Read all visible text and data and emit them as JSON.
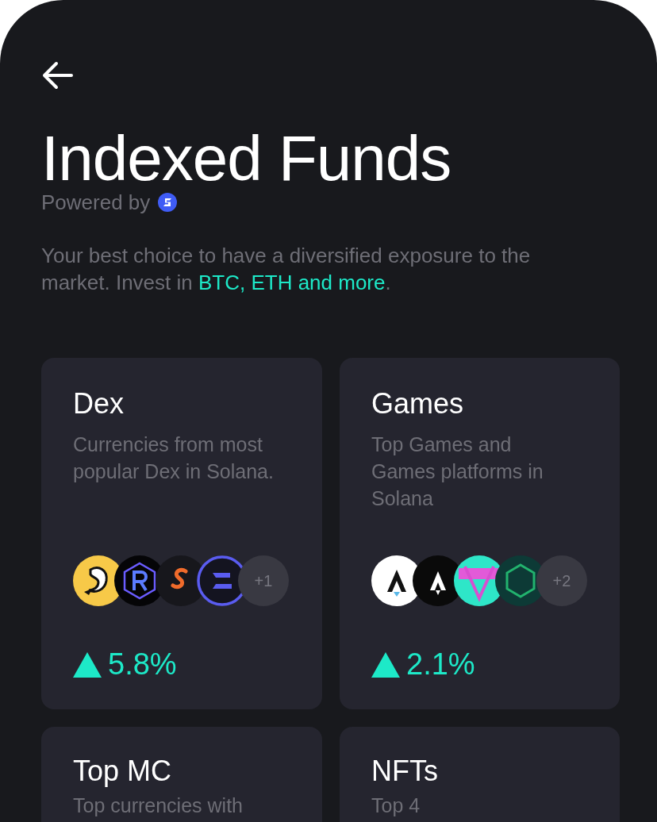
{
  "header": {
    "title": "Indexed Funds",
    "powered_by": "Powered by"
  },
  "intro": {
    "text": "Your best choice to have a diversified exposure to the market. Invest in ",
    "link": "BTC, ETH and more",
    "end": "."
  },
  "funds": [
    {
      "name": "Dex",
      "description": "Currencies from most popular Dex in Solana.",
      "more": "+1",
      "change": "5.8%",
      "kind": "up"
    },
    {
      "name": "Games",
      "description": "Top Games and Games platforms in Solana",
      "more": "+2",
      "change": "2.1%",
      "kind": "up"
    },
    {
      "name": "Top MC",
      "description": "Top currencies with"
    },
    {
      "name": "NFTs",
      "description": "Top 4"
    }
  ]
}
